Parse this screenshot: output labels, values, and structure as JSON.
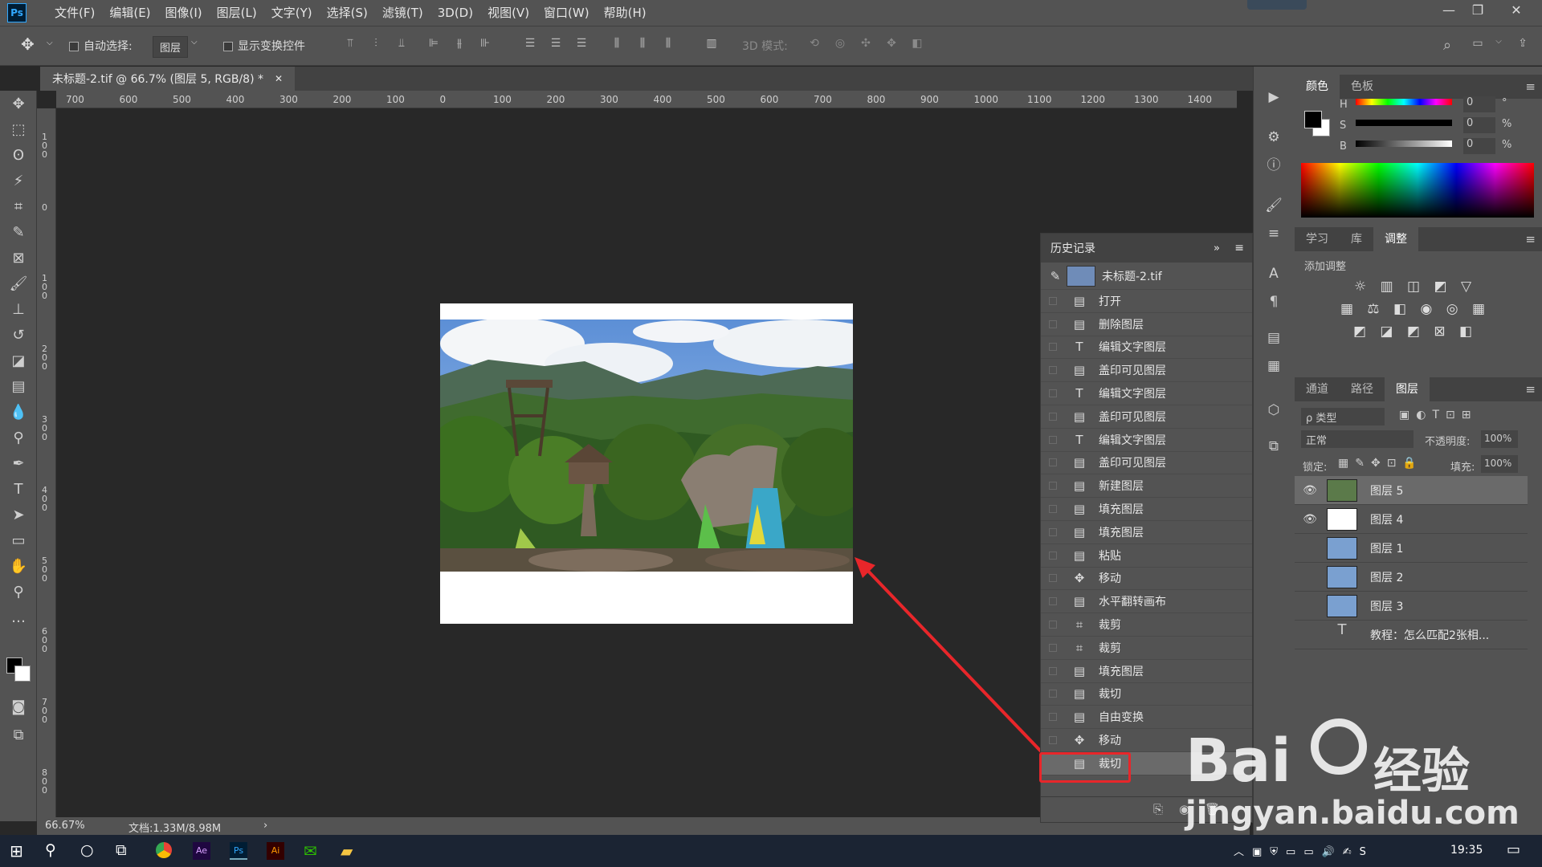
{
  "menubar": {
    "logo": "Ps",
    "items": [
      "文件(F)",
      "编辑(E)",
      "图像(I)",
      "图层(L)",
      "文字(Y)",
      "选择(S)",
      "滤镜(T)",
      "3D(D)",
      "视图(V)",
      "窗口(W)",
      "帮助(H)"
    ]
  },
  "options": {
    "auto_select_label": "自动选择:",
    "auto_select_value": "图层",
    "show_transform_label": "显示变换控件",
    "mode_3d_label": "3D 模式:"
  },
  "document": {
    "tab_title": "未标题-2.tif @ 66.7% (图层 5, RGB/8) *",
    "zoom": "66.67%",
    "doc_size": "文档:1.33M/8.98M"
  },
  "ruler": {
    "h_ticks": [
      "700",
      "600",
      "500",
      "400",
      "300",
      "200",
      "100",
      "0",
      "100",
      "200",
      "300",
      "400",
      "500",
      "600",
      "700",
      "800",
      "900",
      "1000",
      "1100",
      "1200",
      "1300",
      "1400"
    ],
    "v_ticks": [
      "1 0 0",
      "0",
      "1 0 0",
      "2 0 0",
      "3 0 0",
      "4 0 0",
      "5 0 0",
      "6 0 0",
      "7 0 0",
      "8 0 0"
    ]
  },
  "history": {
    "title": "历史记录",
    "snapshot": "未标题-2.tif",
    "items": [
      {
        "icon": "doc-icon",
        "label": "打开"
      },
      {
        "icon": "doc-icon",
        "label": "删除图层"
      },
      {
        "icon": "type-icon",
        "label": "编辑文字图层"
      },
      {
        "icon": "doc-icon",
        "label": "盖印可见图层"
      },
      {
        "icon": "type-icon",
        "label": "编辑文字图层"
      },
      {
        "icon": "doc-icon",
        "label": "盖印可见图层"
      },
      {
        "icon": "type-icon",
        "label": "编辑文字图层"
      },
      {
        "icon": "doc-icon",
        "label": "盖印可见图层"
      },
      {
        "icon": "doc-icon",
        "label": "新建图层"
      },
      {
        "icon": "doc-icon",
        "label": "填充图层"
      },
      {
        "icon": "doc-icon",
        "label": "填充图层"
      },
      {
        "icon": "doc-icon",
        "label": "粘贴"
      },
      {
        "icon": "move-icon",
        "label": "移动"
      },
      {
        "icon": "doc-icon",
        "label": "水平翻转画布"
      },
      {
        "icon": "crop-icon",
        "label": "裁剪"
      },
      {
        "icon": "crop-icon",
        "label": "裁剪"
      },
      {
        "icon": "doc-icon",
        "label": "填充图层"
      },
      {
        "icon": "doc-icon",
        "label": "裁切"
      },
      {
        "icon": "doc-icon",
        "label": "自由变换"
      },
      {
        "icon": "move-icon",
        "label": "移动"
      },
      {
        "icon": "doc-icon",
        "label": "裁切"
      }
    ]
  },
  "color_panel": {
    "tabs": [
      "颜色",
      "色板"
    ],
    "h_label": "H",
    "h_value": "0",
    "h_unit": "°",
    "s_label": "S",
    "s_value": "0",
    "s_unit": "%",
    "b_label": "B",
    "b_value": "0",
    "b_unit": "%"
  },
  "adjust_panel": {
    "tabs": [
      "学习",
      "库",
      "调整"
    ],
    "add_label": "添加调整"
  },
  "layers_panel": {
    "tabs": [
      "通道",
      "路径",
      "图层"
    ],
    "filter": "ρ 类型",
    "blend": "正常",
    "opacity_label": "不透明度:",
    "opacity_value": "100%",
    "lock_label": "锁定:",
    "fill_label": "填充:",
    "fill_value": "100%",
    "layers": [
      {
        "name": "图层 5",
        "visible": true
      },
      {
        "name": "图层 4",
        "visible": true
      },
      {
        "name": "图层 1",
        "visible": false
      },
      {
        "name": "图层 2",
        "visible": false
      },
      {
        "name": "图层 3",
        "visible": false
      },
      {
        "name": "教程：怎么匹配2张相...",
        "visible": false
      }
    ]
  },
  "taskbar": {
    "time": "19:35"
  },
  "watermark": {
    "brand": "Bai",
    "brand2": "经验",
    "url": "jingyan.baidu.com"
  },
  "colors": {
    "highlight": "#e8262a",
    "panel": "#535353",
    "canvas": "#282828"
  }
}
